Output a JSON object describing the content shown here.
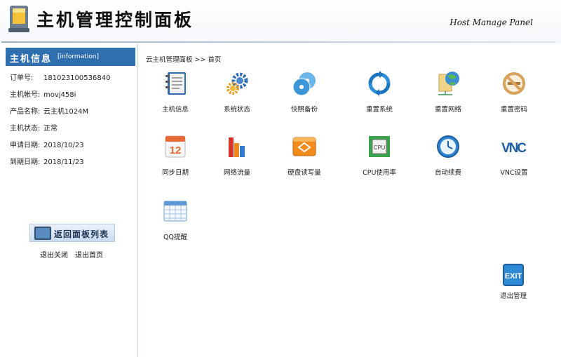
{
  "header": {
    "title": "主机管理控制面板",
    "subtitle": "Host Manage Panel"
  },
  "sidebar": {
    "heading": "主机信息",
    "heading_en": "[information]",
    "info": [
      {
        "label": "订单号:",
        "value": "181023100536840"
      },
      {
        "label": "主机帐号:",
        "value": "movj458i"
      },
      {
        "label": "产品名称:",
        "value": "云主机1024M"
      },
      {
        "label": "主机状态:",
        "value": "正常"
      },
      {
        "label": "申请日期:",
        "value": "2018/10/23"
      },
      {
        "label": "到期日期:",
        "value": "2018/11/23"
      }
    ],
    "back_button": "返回面板列表",
    "logout_close": "退出关闭",
    "logout_home": "退出首页"
  },
  "breadcrumb": "云主机管理面板 >> 首页",
  "tiles": [
    {
      "icon": "notebook-icon",
      "label": "主机信息"
    },
    {
      "icon": "gears-icon",
      "label": "系统状态"
    },
    {
      "icon": "discs-icon",
      "label": "快照备份"
    },
    {
      "icon": "refresh-arrows-icon",
      "label": "重置系统"
    },
    {
      "icon": "network-globe-icon",
      "label": "重置网络"
    },
    {
      "icon": "no-smoking-key-icon",
      "label": "重置密码"
    },
    {
      "icon": "calendar-12-icon",
      "label": "同步日期"
    },
    {
      "icon": "bar-chart-icon",
      "label": "网络流量"
    },
    {
      "icon": "hard-disk-icon",
      "label": "硬盘读写量"
    },
    {
      "icon": "cpu-chip-icon",
      "label": "CPU使用率"
    },
    {
      "icon": "clock-icon",
      "label": "自动续费"
    },
    {
      "icon": "vnc-text-icon",
      "label": "VNC设置"
    },
    {
      "icon": "calendar-grid-icon",
      "label": "QQ提醒"
    }
  ],
  "exit": {
    "icon": "exit-sign-icon",
    "label": "退出管理"
  }
}
